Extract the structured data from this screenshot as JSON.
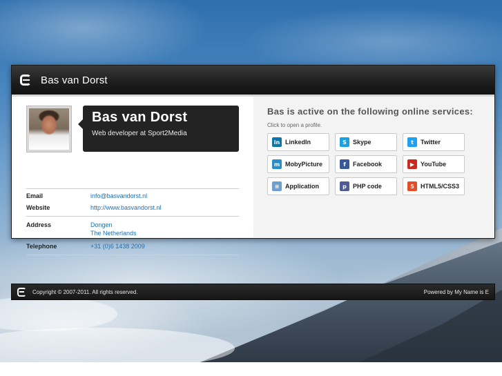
{
  "header": {
    "title": "Bas van Dorst"
  },
  "profile": {
    "name": "Bas van Dorst",
    "subtitle": "Web developer at Sport2Media"
  },
  "details": {
    "email_label": "Email",
    "email_value": "info@basvandorst.nl",
    "website_label": "Website",
    "website_value": "http://www.basvandorst.nl",
    "address_label": "Address",
    "address_line1": "Dongen",
    "address_line2": "The Netherlands",
    "telephone_label": "Telephone",
    "telephone_value": "+31 (0)6 1438 2009"
  },
  "services": {
    "title": "Bas is active on the following online services:",
    "hint": "Click to open a profile.",
    "items": [
      {
        "label": "LinkedIn",
        "icon": "linkedin-icon",
        "color": "#0e76a8",
        "glyph": "in"
      },
      {
        "label": "Skype",
        "icon": "skype-icon",
        "color": "#1aa1e1",
        "glyph": "S"
      },
      {
        "label": "Twitter",
        "icon": "twitter-icon",
        "color": "#1da1f2",
        "glyph": "t"
      },
      {
        "label": "MobyPicture",
        "icon": "mobypicture-icon",
        "color": "#2a8fc8",
        "glyph": "m"
      },
      {
        "label": "Facebook",
        "icon": "facebook-icon",
        "color": "#3b5998",
        "glyph": "f"
      },
      {
        "label": "YouTube",
        "icon": "youtube-icon",
        "color": "#cc2a1f",
        "glyph": "▶"
      },
      {
        "label": "Application",
        "icon": "application-icon",
        "color": "#6d9fd0",
        "glyph": "≡"
      },
      {
        "label": "PHP code",
        "icon": "php-icon",
        "color": "#4f5b93",
        "glyph": "p"
      },
      {
        "label": "HTML5/CSS3",
        "icon": "html5-icon",
        "color": "#e44d26",
        "glyph": "5"
      }
    ]
  },
  "footer": {
    "copyright": "Copyright © 2007-2011. All rights reserved.",
    "powered": "Powered by My Name is E"
  }
}
